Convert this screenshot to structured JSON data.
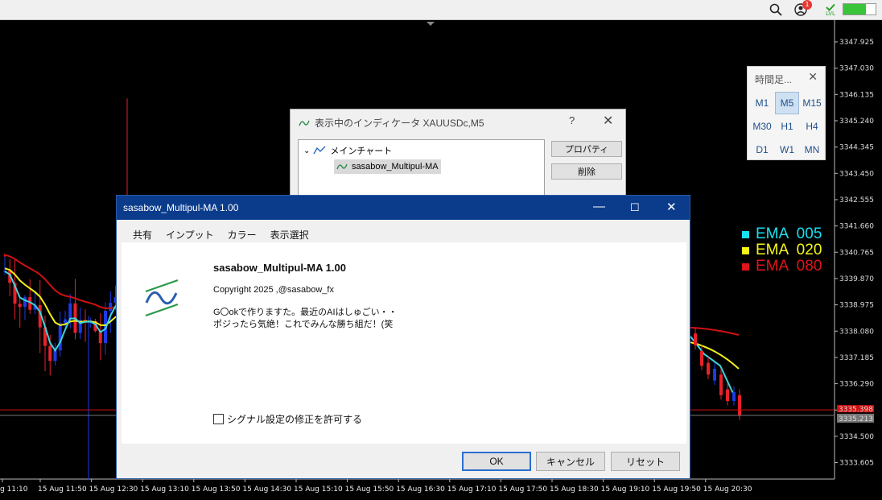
{
  "topbar": {
    "notification_count": "1",
    "level_label": "LVL",
    "battery_fill": 0.7
  },
  "chart": {
    "price_labels": [
      "3347.925",
      "3347.030",
      "3346.135",
      "3345.240",
      "3344.345",
      "3343.450",
      "3342.555",
      "3341.660",
      "3340.765",
      "3339.870",
      "3338.975",
      "3338.080",
      "3337.185",
      "3336.290",
      "3335.395",
      "3334.500",
      "3333.605"
    ],
    "bid_price": "3335.398",
    "ask_price": "3335.213",
    "time_labels": [
      "g 11:10",
      "15 Aug 11:50",
      "15 Aug 12:30",
      "15 Aug 13:10",
      "15 Aug 13:50",
      "15 Aug 14:30",
      "15 Aug 15:10",
      "15 Aug 15:50",
      "15 Aug 16:30",
      "15 Aug 17:10",
      "15 Aug 17:50",
      "15 Aug 18:30",
      "15 Aug 19:10",
      "15 Aug 19:50",
      "15 Aug 20:30"
    ],
    "colors": {
      "bull": "#1c3be6",
      "bear": "#e8212b",
      "ema_fast": "#3fd3dc",
      "ema_mid": "#f3f11a",
      "ema_slow": "#d01010"
    }
  },
  "ema_legend": [
    {
      "label": "EMA  005",
      "color": "#19e0f0"
    },
    {
      "label": "EMA  020",
      "color": "#f5f51a"
    },
    {
      "label": "EMA  080",
      "color": "#e0141a"
    }
  ],
  "timeframes": {
    "title": "時間足...",
    "items": [
      "M1",
      "M5",
      "M15",
      "M30",
      "H1",
      "H4",
      "D1",
      "W1",
      "MN"
    ],
    "selected": "M5"
  },
  "indicators_dialog": {
    "title": "表示中のインディケータ XAUUSDc,M5",
    "help": "?",
    "tree_root": "メインチャート",
    "tree_item": "sasabow_Multipul-MA",
    "btn_properties": "プロパティ",
    "btn_delete": "削除"
  },
  "main_dialog": {
    "title": "sasabow_Multipul-MA 1.00",
    "tabs": [
      "共有",
      "インプット",
      "カラー",
      "表示選択"
    ],
    "active_tab": "共有",
    "product_name": "sasabow_Multipul-MA 1.00",
    "copyright": "Copyright 2025 ,@sasabow_fx",
    "desc_line1": "G〇okで作りますた。最近のAIはしゅごい・・",
    "desc_line2": "ポジったら気絶！これでみんな勝ち組だ！(笑",
    "checkbox_label": "シグナル設定の修正を許可する",
    "ok": "OK",
    "cancel": "キャンセル",
    "reset": "リセット"
  }
}
